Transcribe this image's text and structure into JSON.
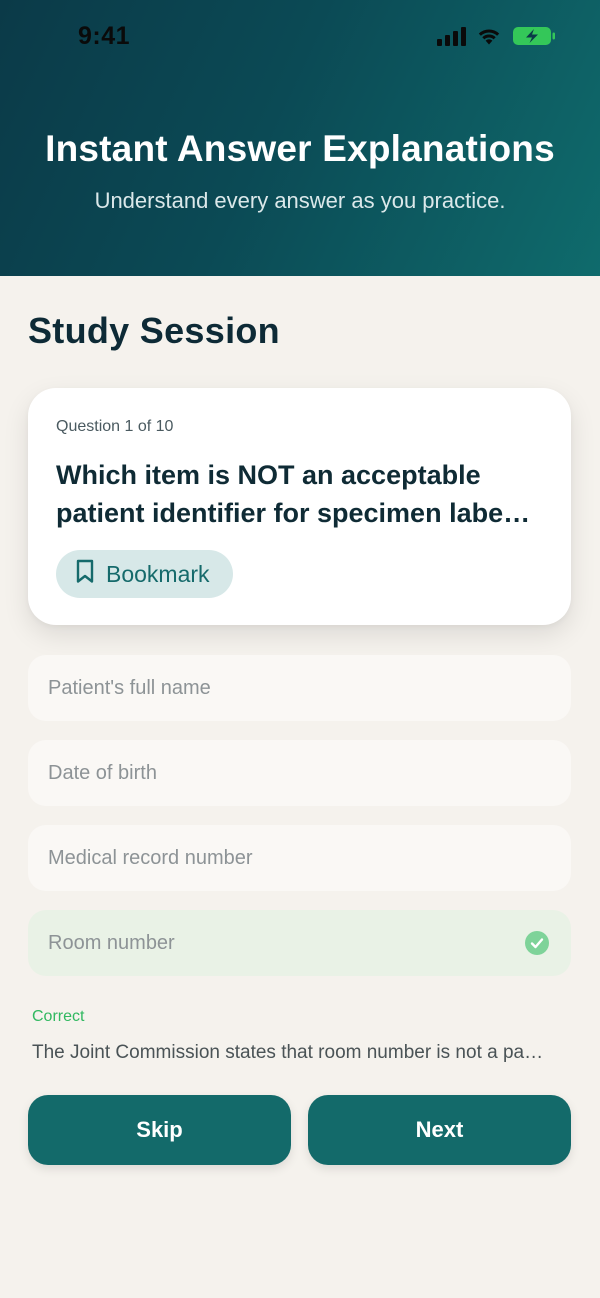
{
  "status_bar": {
    "time": "9:41"
  },
  "header": {
    "title": "Instant Answer Explanations",
    "subtitle": "Understand every answer as you practice."
  },
  "session": {
    "title": "Study Session"
  },
  "question": {
    "counter": "Question 1 of 10",
    "text_line1": "Which item is NOT an acceptable",
    "text_line2": "patient identifier for specimen labe…",
    "bookmark_label": "Bookmark"
  },
  "options": [
    {
      "label": "Patient's full name"
    },
    {
      "label": "Date of birth"
    },
    {
      "label": "Medical record number"
    },
    {
      "label": "Room number",
      "state": "correct"
    }
  ],
  "feedback": {
    "label": "Correct",
    "explanation": "The Joint Commission states that room number is not a pa…"
  },
  "actions": {
    "skip_label": "Skip",
    "next_label": "Next"
  },
  "colors": {
    "header_start": "#0b3a48",
    "header_end": "#0f6b6c",
    "primary": "#136a6a",
    "correct_bg": "#e9f2e6",
    "correct_check": "#7ed399",
    "correct_text": "#30b860",
    "battery": "#34c759"
  },
  "icons": {
    "signal": "cellular-signal-icon",
    "wifi": "wifi-icon",
    "battery": "battery-charging-icon",
    "bookmark": "bookmark-icon",
    "check": "checkmark-circle-icon"
  }
}
